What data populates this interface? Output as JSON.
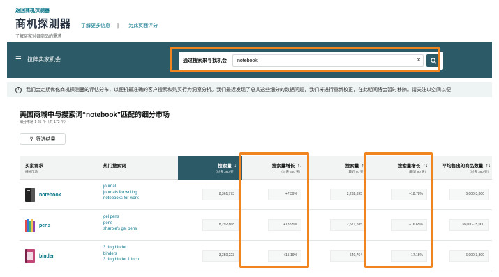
{
  "header": {
    "back_link": "返回商机探测器",
    "app_title": "商机探测器",
    "link_learn_more": "了解更多信息",
    "separator": "|",
    "link_feedback": "为此页面评分",
    "subtitle": "了解买家对各商品的需求"
  },
  "toolbar": {
    "menu_label": "拉伸卖家机会",
    "search_label": "通过搜索来寻找机会",
    "search_value": "notebook",
    "clear_symbol": "×",
    "search_symbol": "🔍"
  },
  "info": {
    "icon": "i",
    "text": "我们会定期优化商机探测器的评估分布，以便机最准确的客户搜索和购买行为洞察分析。我们最近发现了总共这些细分的数据问题，我们将进行重新校正，在此期间将会暂时移除。请关注以空间以便"
  },
  "section": {
    "title": "美国商城中与搜索词“notebook”匹配的细分市场",
    "result_count": "细分市场 1-25 个（共 172 个）",
    "filter_label": "筛选结果",
    "filter_icon": "⊽"
  },
  "table": {
    "headers": [
      {
        "label": "买家需求",
        "sub": "细分市场"
      },
      {
        "label": "热门搜索词",
        "sub": ""
      },
      {
        "label": "搜索量",
        "sub": "（过去 360 天）",
        "sort": "↓"
      },
      {
        "label": "搜索量增长",
        "sub": "（过去 360 天）",
        "sort": "↑↓"
      },
      {
        "label": "搜索量",
        "sub": "（最近 90 天）",
        "sort": "↑↓"
      },
      {
        "label": "搜索量增长",
        "sub": "（最近 90 天）",
        "sort": "↑↓"
      },
      {
        "label": "平均售出的商品数量",
        "sub": "（过去 360 天）",
        "sort": "↑↓"
      }
    ],
    "rows": [
      {
        "name": "notebook",
        "terms": [
          "journal",
          "journals for writing",
          "notebooks for work"
        ],
        "values": [
          "8,361,773",
          "+7.39%",
          "2,232,695",
          "+18.78%",
          "6,000-3,800"
        ]
      },
      {
        "name": "pens",
        "terms": [
          "gel pens",
          "pens",
          "sharpie's gel pens"
        ],
        "values": [
          "8,292,868",
          "+18.95%",
          "2,571,785",
          "+16.65%",
          "36,000-75,000"
        ]
      },
      {
        "name": "binder",
        "terms": [
          "3 ring binder",
          "binders",
          "3 ring binder 1 inch"
        ],
        "values": [
          "3,350,223",
          "+15.19%",
          "540,764",
          "-17.15%",
          "6,000-3,800"
        ]
      }
    ]
  },
  "colors": {
    "teal": "#2c5a67",
    "highlight_orange": "#f0841f",
    "link": "#007185"
  }
}
